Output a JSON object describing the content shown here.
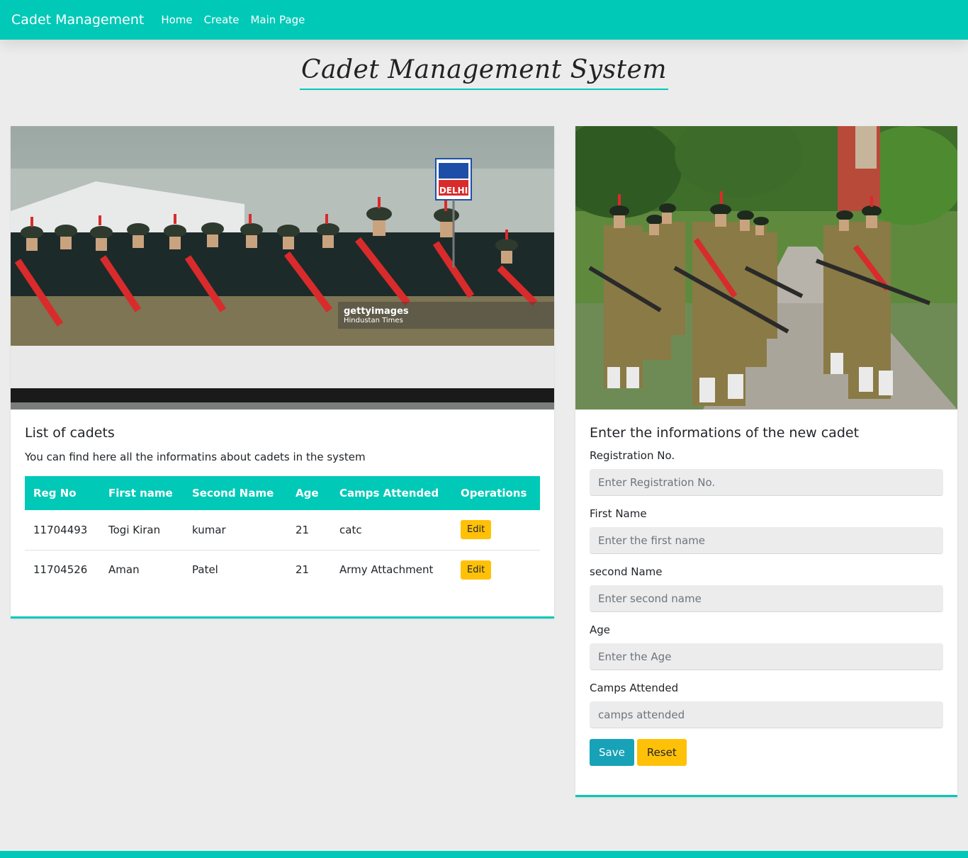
{
  "navbar": {
    "brand": "Cadet Management",
    "links": [
      "Home",
      "Create",
      "Main Page"
    ]
  },
  "page_title": "Cadet Management System",
  "list_card": {
    "image_alt": "NCC cadets marching in parade",
    "watermark_brand": "gettyimages",
    "watermark_sub": "Hindustan Times",
    "title": "List of cadets",
    "description": "You can find here all the informatins about cadets in the system",
    "columns": [
      "Reg No",
      "First name",
      "Second Name",
      "Age",
      "Camps Attended",
      "Operations"
    ],
    "rows": [
      {
        "reg_no": "11704493",
        "first_name": "Togi Kiran",
        "second_name": "kumar",
        "age": "21",
        "camps": "catc",
        "action": "Edit"
      },
      {
        "reg_no": "11704526",
        "first_name": "Aman",
        "second_name": "Patel",
        "age": "21",
        "camps": "Army Attachment",
        "action": "Edit"
      }
    ]
  },
  "form_card": {
    "image_alt": "NCC cadets marching with rifles",
    "title": "Enter the informations of the new cadet",
    "fields": [
      {
        "label": "Registration No.",
        "placeholder": "Enter Registration No."
      },
      {
        "label": "First Name",
        "placeholder": "Enter the first name"
      },
      {
        "label": "second Name",
        "placeholder": "Enter second name"
      },
      {
        "label": "Age",
        "placeholder": "Enter the Age"
      },
      {
        "label": "Camps Attended",
        "placeholder": "camps attended"
      }
    ],
    "save_label": "Save",
    "reset_label": "Reset"
  },
  "colors": {
    "accent": "#00c9b7",
    "warning": "#ffc107",
    "info": "#17a2b8",
    "background": "#ececec"
  }
}
